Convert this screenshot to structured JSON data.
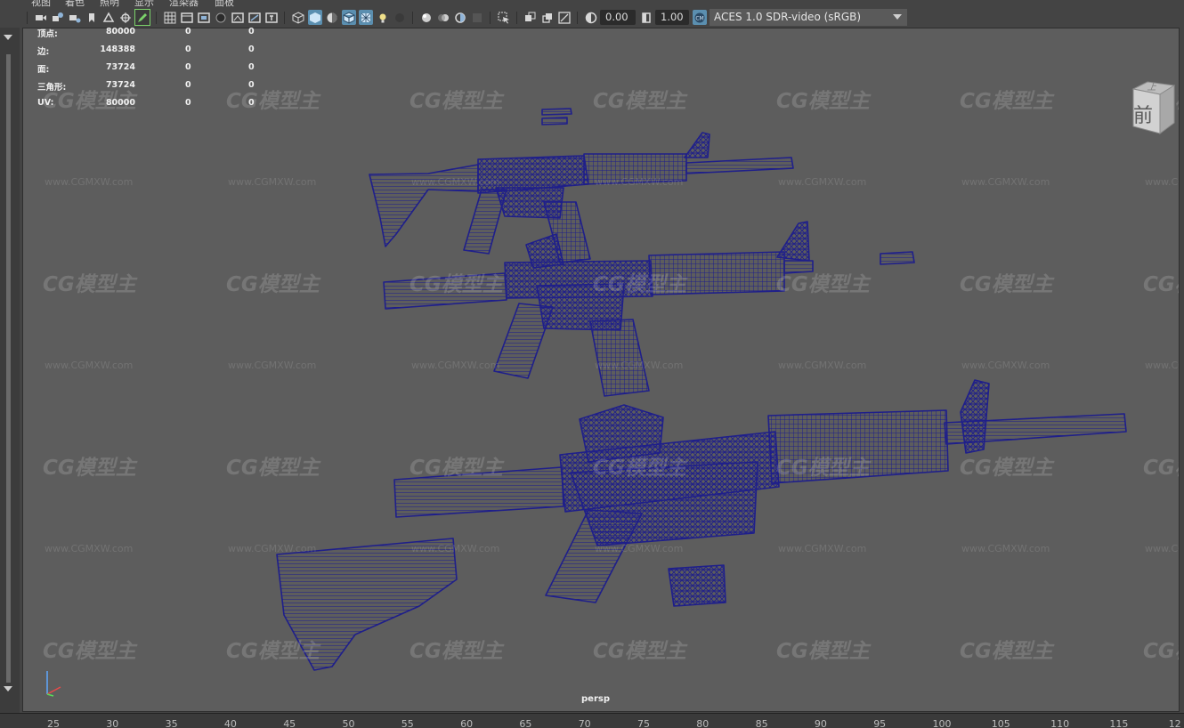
{
  "menu": [
    "视图",
    "着色",
    "照明",
    "显示",
    "渲染器",
    "面板"
  ],
  "toolbar": {
    "exposure": "0.00",
    "gamma": "1.00",
    "color_management": "ACES 1.0 SDR-video (sRGB)"
  },
  "hud": {
    "rows": [
      {
        "label": "顶点:",
        "v1": "80000",
        "v2": "0",
        "v3": "0"
      },
      {
        "label": "边:",
        "v1": "148388",
        "v2": "0",
        "v3": "0"
      },
      {
        "label": "面:",
        "v1": "73724",
        "v2": "0",
        "v3": "0"
      },
      {
        "label": "三角形:",
        "v1": "73724",
        "v2": "0",
        "v3": "0"
      },
      {
        "label": "UV:",
        "v1": "80000",
        "v2": "0",
        "v3": "0"
      }
    ]
  },
  "viewcube": {
    "top_face": "上",
    "front_face": "前"
  },
  "camera_label": "persp",
  "timeline_ticks": [
    "25",
    "30",
    "35",
    "40",
    "45",
    "50",
    "55",
    "60",
    "65",
    "70",
    "75",
    "80",
    "85",
    "90",
    "95",
    "100",
    "105",
    "110",
    "115",
    "12"
  ],
  "watermark": {
    "logo": "CG模型主",
    "url": "www.CGMXW.com"
  },
  "colors": {
    "wireframe": "#1f1f8a",
    "viewport_bg": "#5d5d5d",
    "active_icon": "#5b8fb0"
  }
}
